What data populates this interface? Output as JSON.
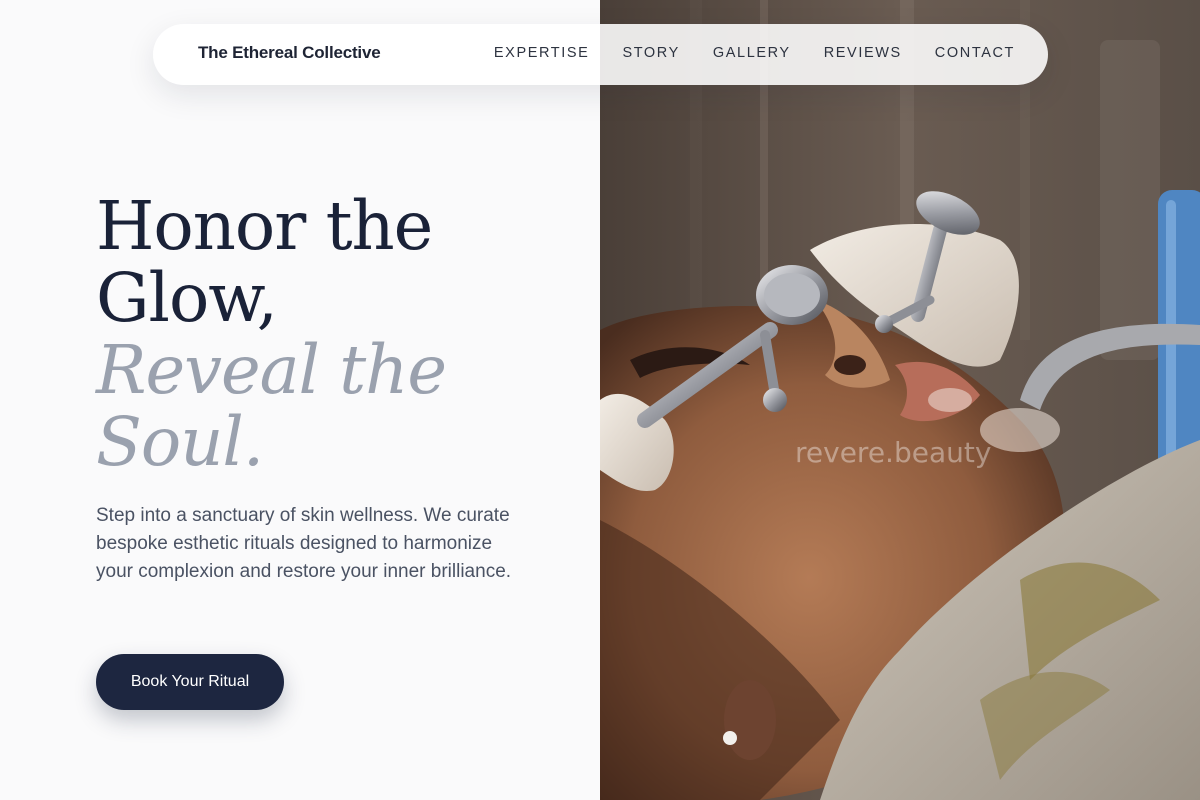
{
  "nav": {
    "brand": "The Ethereal Collective",
    "links": [
      "EXPERTISE",
      "STORY",
      "GALLERY",
      "REVIEWS",
      "CONTACT"
    ]
  },
  "hero": {
    "headline_line1": "Honor the",
    "headline_line2": "Glow,",
    "headline_italic_line1": "Reveal the",
    "headline_italic_line2": "Soul.",
    "lede": "Step into a sanctuary of skin wellness. We curate bespoke esthetic rituals designed to harmonize your complexion and restore your inner brilliance.",
    "cta_label": "Book Your Ritual"
  },
  "photo": {
    "watermark": "revere.beauty"
  },
  "colors": {
    "navy": "#1d2640",
    "muted_italic": "#9aa1ae",
    "body_text": "#4a5263",
    "background": "#fafafb"
  }
}
